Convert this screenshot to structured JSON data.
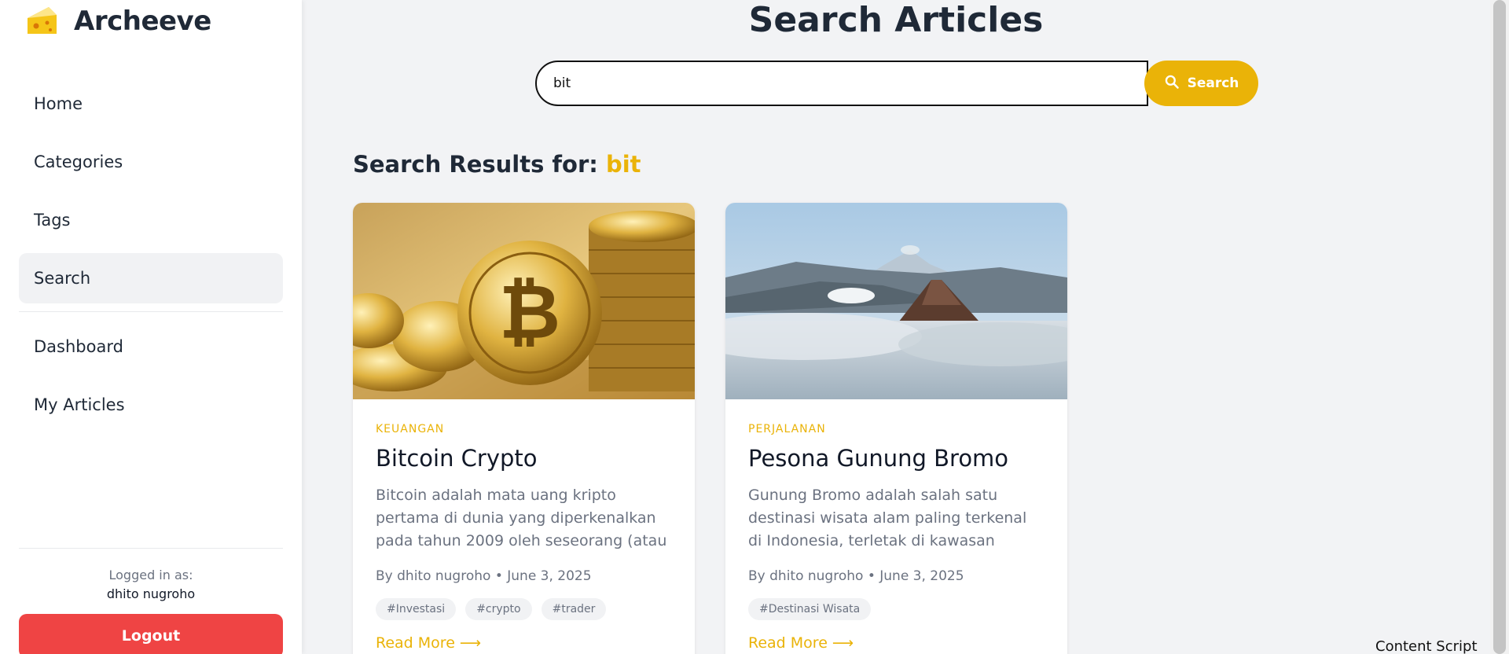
{
  "app": {
    "name": "Archeeve"
  },
  "sidebar": {
    "nav": [
      "Home",
      "Categories",
      "Tags",
      "Search"
    ],
    "nav2": [
      "Dashboard",
      "My Articles"
    ],
    "logged_label": "Logged in as:",
    "user": "dhito nugroho",
    "logout_label": "Logout"
  },
  "main": {
    "title": "Search Articles",
    "search": {
      "value": "bit",
      "button_label": "Search"
    },
    "results_prefix": "Search Results for:",
    "query": "bit",
    "cards": [
      {
        "category": "KEUANGAN",
        "title": "Bitcoin Crypto",
        "excerpt": "Bitcoin adalah mata uang kripto pertama di dunia yang diperkenalkan pada tahun 2009 oleh seseorang (atau sekelompok orang)...",
        "meta": "By dhito nugroho • June 3, 2025",
        "tags": [
          "#Investasi",
          "#crypto",
          "#trader"
        ],
        "read_more": "Read More ⟶"
      },
      {
        "category": "PERJALANAN",
        "title": "Pesona Gunung Bromo",
        "excerpt": "Gunung Bromo adalah salah satu destinasi wisata alam paling terkenal di Indonesia, terletak di kawasan Taman Nasional Brom...",
        "meta": "By dhito nugroho • June 3, 2025",
        "tags": [
          "#Destinasi Wisata"
        ],
        "read_more": "Read More ⟶"
      }
    ]
  },
  "overlay": {
    "content_script": "Content Script"
  },
  "colors": {
    "accent": "#eab308",
    "logout": "#ef4444",
    "active_nav": "#f1f2f4"
  }
}
